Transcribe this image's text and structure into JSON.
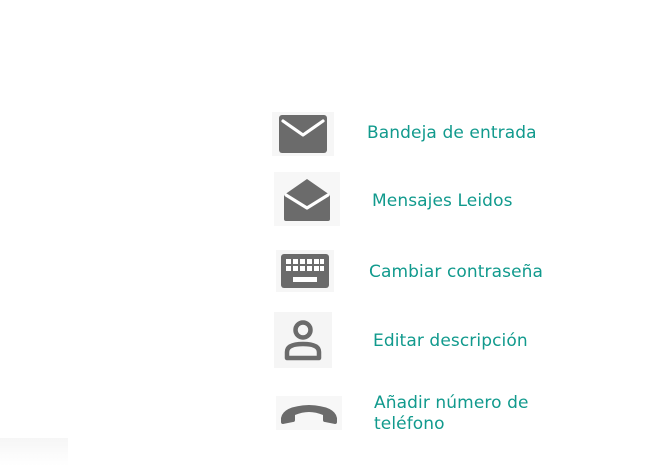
{
  "menu": {
    "items": [
      {
        "id": "inbox",
        "label": "Bandeja de entrada",
        "icon": "mail-closed-icon"
      },
      {
        "id": "read",
        "label": "Mensajes Leidos",
        "icon": "mail-open-icon"
      },
      {
        "id": "password",
        "label": "Cambiar contraseña",
        "icon": "keyboard-icon"
      },
      {
        "id": "description",
        "label": "Editar descripción",
        "icon": "person-icon"
      },
      {
        "id": "phone",
        "label": "Añadir número de teléfono",
        "icon": "phone-icon"
      }
    ]
  },
  "colors": {
    "label": "#119a8d",
    "icon": "#6b6b6b",
    "icon_box": "#f4f4f4"
  }
}
